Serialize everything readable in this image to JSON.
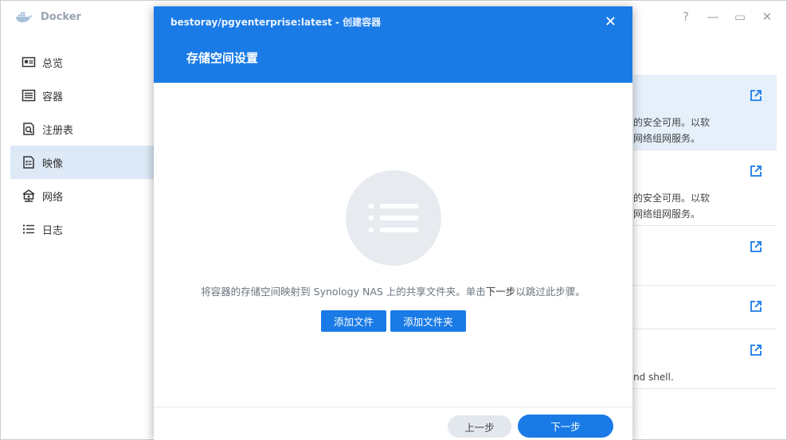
{
  "app": {
    "title": "Docker"
  },
  "window_controls": {
    "help": "?",
    "minimize": "—",
    "maximize": "▭",
    "close": "✕"
  },
  "sidebar": {
    "items": [
      {
        "label": "总览",
        "icon": "overview-icon"
      },
      {
        "label": "容器",
        "icon": "container-list-icon"
      },
      {
        "label": "注册表",
        "icon": "registry-search-icon"
      },
      {
        "label": "映像",
        "icon": "image-icon",
        "active": true
      },
      {
        "label": "网络",
        "icon": "network-icon"
      },
      {
        "label": "日志",
        "icon": "log-list-icon"
      }
    ]
  },
  "background_list": {
    "rows": [
      {
        "line1": "的安全可用。以软",
        "line2": "网络组网服务。"
      },
      {
        "line1": "的安全可用。以软",
        "line2": "网络组网服务。"
      },
      {
        "line1": "",
        "line2": ""
      },
      {
        "line1": "",
        "line2": ""
      },
      {
        "line1": "nd shell.",
        "line2": ""
      }
    ]
  },
  "dialog": {
    "title": "bestoray/pgyenterprise:latest - 创建容器",
    "close_icon": "✕",
    "subtitle": "存储空间设置",
    "description_prefix": "将容器的存储空间映射到 Synology NAS 上的共享文件夹。单击",
    "description_emphasis": "下一步",
    "description_suffix": "以跳过此步骤。",
    "add_file_button": "添加文件",
    "add_folder_button": "添加文件夹",
    "prev_button": "上一步",
    "next_button": "下一步"
  },
  "colors": {
    "accent": "#1a7be6",
    "sidebar_active": "#dde9f7"
  }
}
